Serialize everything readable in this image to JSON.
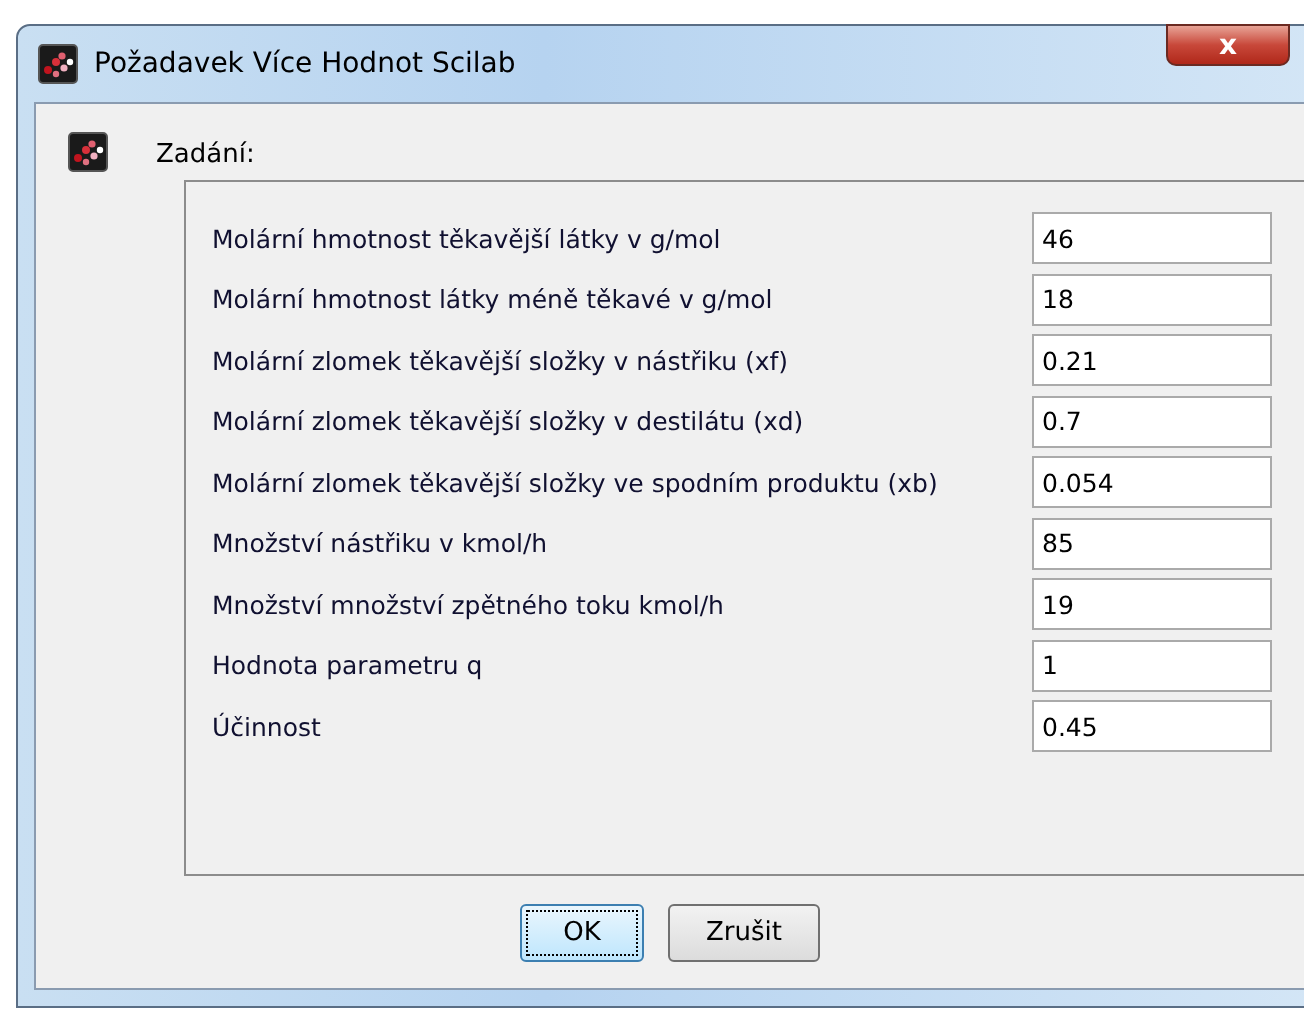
{
  "window": {
    "title": "Požadavek Více Hodnot Scilab",
    "close": "x"
  },
  "section_label": "Zadání:",
  "fields": [
    {
      "label": "Molární hmotnost těkavější látky v g/mol",
      "value": "46"
    },
    {
      "label": "Molární hmotnost látky méně těkavé v g/mol",
      "value": "18"
    },
    {
      "label": "Molární zlomek těkavější složky v nástřiku (xf)",
      "value": "0.21"
    },
    {
      "label": "Molární zlomek těkavější složky v destilátu (xd)",
      "value": "0.7"
    },
    {
      "label": "Molární zlomek těkavější složky ve spodním produktu (xb)",
      "value": "0.054"
    },
    {
      "label": "Množství nástřiku v kmol/h",
      "value": "85"
    },
    {
      "label": "Množství množství zpětného toku kmol/h",
      "value": "19"
    },
    {
      "label": "Hodnota parametru q",
      "value": "1"
    },
    {
      "label": "Účinnost",
      "value": "0.45"
    }
  ],
  "buttons": [
    {
      "label": "OK",
      "focused": true
    },
    {
      "label": "Zrušit",
      "focused": false
    }
  ]
}
